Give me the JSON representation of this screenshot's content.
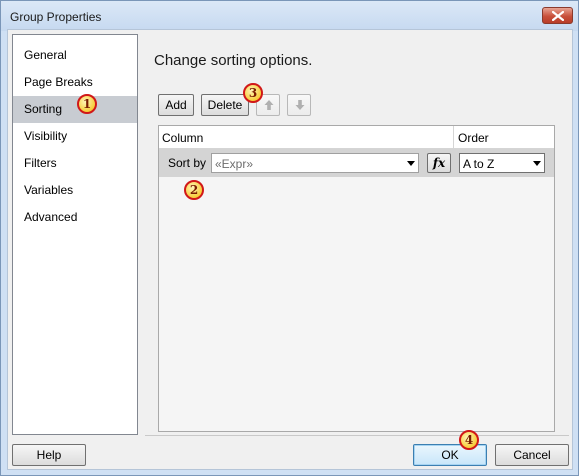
{
  "window": {
    "title": "Group Properties"
  },
  "nav": {
    "items": [
      {
        "label": "General"
      },
      {
        "label": "Page Breaks"
      },
      {
        "label": "Sorting"
      },
      {
        "label": "Visibility"
      },
      {
        "label": "Filters"
      },
      {
        "label": "Variables"
      },
      {
        "label": "Advanced"
      }
    ],
    "selected": "Sorting"
  },
  "main": {
    "heading": "Change sorting options.",
    "toolbar": {
      "add_label": "Add",
      "delete_label": "Delete",
      "move_up_icon": "arrow-up-icon",
      "move_down_icon": "arrow-down-icon"
    },
    "grid": {
      "columns": [
        "Column",
        "Order"
      ],
      "rows": [
        {
          "label": "Sort by",
          "expression_placeholder": "«Expr»",
          "order": "A to Z"
        }
      ]
    }
  },
  "footer": {
    "help_label": "Help",
    "ok_label": "OK",
    "cancel_label": "Cancel"
  },
  "callouts": [
    "1",
    "2",
    "3",
    "4"
  ]
}
